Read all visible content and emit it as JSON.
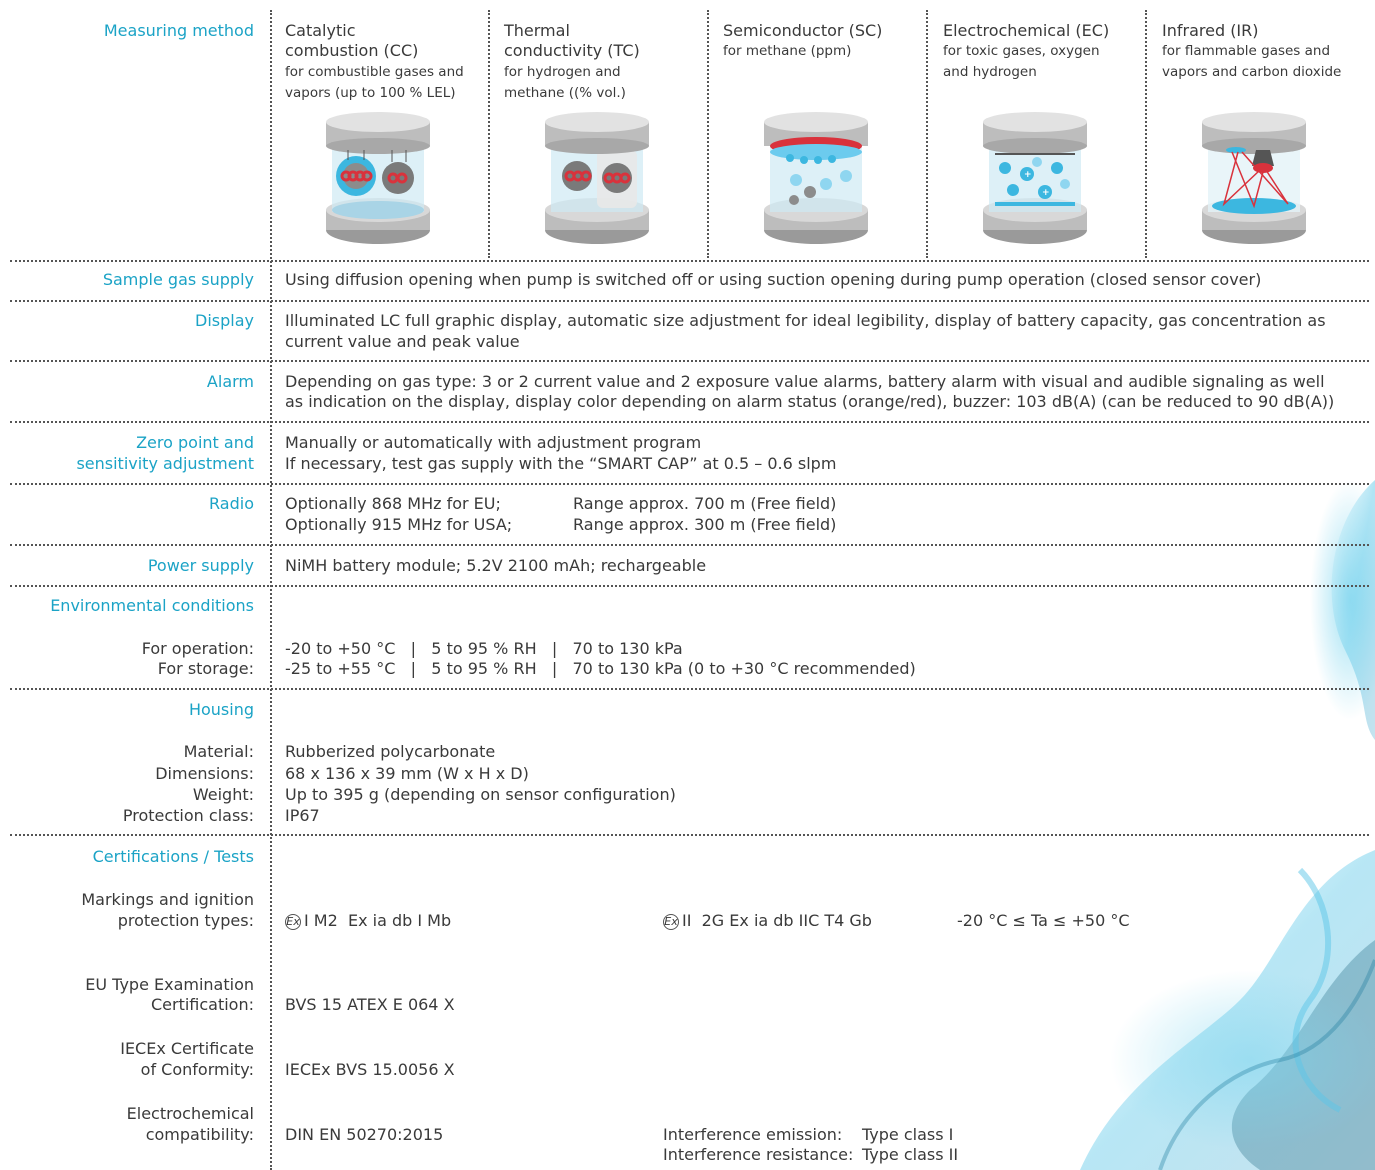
{
  "measuring_method": {
    "label": "Measuring method",
    "methods": [
      {
        "title_line1": "Catalytic",
        "title_line2": "combustion (CC)",
        "sub_line1": "for combustible gases and",
        "sub_line2": "vapors (up to 100 % LEL)",
        "icon": "catalytic-combustion-sensor-icon"
      },
      {
        "title_line1": "Thermal",
        "title_line2": "conductivity (TC)",
        "sub_line1": "for hydrogen and",
        "sub_line2": "methane ((% vol.)",
        "icon": "thermal-conductivity-sensor-icon"
      },
      {
        "title_line1": "Semiconductor (SC)",
        "title_line2": "",
        "sub_line1": "for methane (ppm)",
        "sub_line2": "",
        "icon": "semiconductor-sensor-icon"
      },
      {
        "title_line1": "Electrochemical (EC)",
        "title_line2": "",
        "sub_line1": "for toxic gases, oxygen",
        "sub_line2": "and hydrogen",
        "icon": "electrochemical-sensor-icon"
      },
      {
        "title_line1": "Infrared (IR)",
        "title_line2": "",
        "sub_line1": "for flammable gases and",
        "sub_line2": "vapors and carbon dioxide",
        "icon": "infrared-sensor-icon"
      }
    ]
  },
  "sample_gas_supply": {
    "label": "Sample gas supply",
    "text": "Using diffusion opening when pump is switched off or using suction opening during pump operation (closed sensor cover)"
  },
  "display": {
    "label": "Display",
    "line1": "Illuminated LC full graphic display, automatic size adjustment for ideal legibility, display of battery capacity, gas concentration as",
    "line2": "current value and peak value"
  },
  "alarm": {
    "label": "Alarm",
    "line1": "Depending on gas type: 3 or 2 current value and 2 exposure value alarms, battery alarm with visual and audible signaling as well",
    "line2": "as indication on the display, display color depending on alarm status (orange/red), buzzer: 103 dB(A) (can be reduced to 90 dB(A))"
  },
  "zero_point": {
    "label_line1": "Zero point and",
    "label_line2": "sensitivity adjustment",
    "line1": "Manually or automatically with adjustment program",
    "line2": "If necessary, test gas supply with the “SMART CAP” at 0.5 – 0.6 slpm"
  },
  "radio": {
    "label": "Radio",
    "row1_a": "Optionally 868 MHz for EU;",
    "row1_b": "Range approx. 700 m (Free field)",
    "row2_a": "Optionally 915 MHz for USA;",
    "row2_b": "Range approx. 300 m (Free field)"
  },
  "power_supply": {
    "label": "Power supply",
    "text": "NiMH battery module; 5.2V 2100 mAh; rechargeable"
  },
  "environmental": {
    "label": "Environmental conditions",
    "operation_label": "For operation:",
    "operation_value": "-20 to +50 °C   |   5 to 95 % RH   |   70 to 130 kPa",
    "storage_label": "For storage:",
    "storage_value": "-25 to +55 °C   |   5 to 95 % RH   |   70 to 130 kPa (0 to +30 °C recommended)"
  },
  "housing": {
    "label": "Housing",
    "rows": [
      {
        "label": "Material:",
        "value": "Rubberized polycarbonate"
      },
      {
        "label": "Dimensions:",
        "value": "68 x 136 x 39 mm (W x H x D)"
      },
      {
        "label": "Weight:",
        "value": "Up to 395 g (depending on sensor configuration)"
      },
      {
        "label": "Protection class:",
        "value": "IP67"
      }
    ]
  },
  "certifications": {
    "label": "Certifications / Tests",
    "markings_label_line1": "Markings and ignition",
    "markings_label_line2": "protection types:",
    "ex_symbol": "Ex",
    "marking1": "I M2  Ex ia db I Mb",
    "marking2": "II  2G Ex ia db IIC T4 Gb",
    "marking3": "-20 °C ≤ Ta ≤ +50 °C",
    "eu_label_line1": "EU Type Examination",
    "eu_label_line2": "Certification:",
    "eu_value": "BVS 15 ATEX E 064 X",
    "iecex_label_line1": "IECEx Certificate",
    "iecex_label_line2": "of Conformity:",
    "iecex_value": "IECEx BVS 15.0056 X",
    "emc_label_line1": "Electrochemical",
    "emc_label_line2": "compatibility:",
    "emc_value": "DIN EN 50270:2015",
    "emission_label": "Interference emission:",
    "emission_value": "Type class I",
    "resistance_label": "Interference resistance:",
    "resistance_value": "Type class II"
  },
  "colors": {
    "accent": "#1ba3c6",
    "text": "#3a3a3a",
    "sensor_blue": "#3cb7e0",
    "sensor_red": "#d9323c"
  }
}
